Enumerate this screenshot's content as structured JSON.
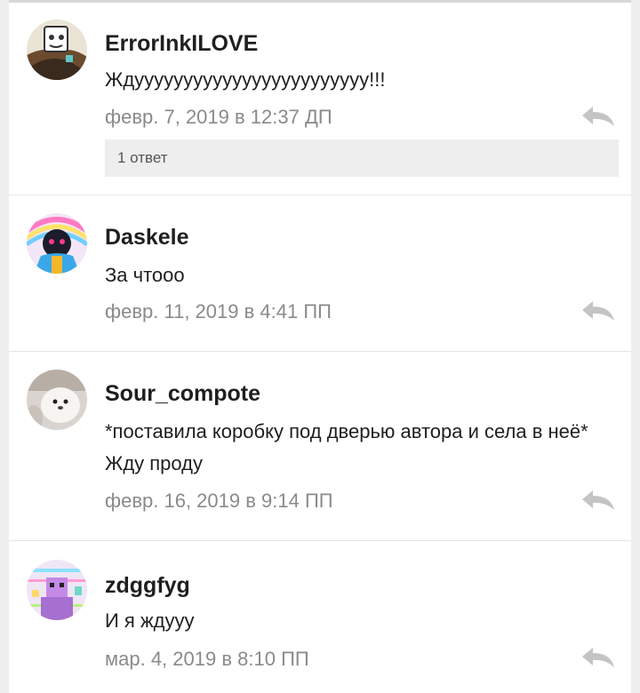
{
  "comments": [
    {
      "username": "ErrorInkILOVE",
      "text": "Ждуууууууууууууууууууууууу!!!",
      "date": "февр. 7, 2019 в 12:37 ДП",
      "replies": "1 ответ"
    },
    {
      "username": "Daskele",
      "text": "За чтооо",
      "date": "февр. 11, 2019 в 4:41 ПП"
    },
    {
      "username": "Sour_compote",
      "text": "*поставила коробку под дверью автора и села в неё* Жду проду",
      "date": "февр. 16, 2019 в 9:14 ПП"
    },
    {
      "username": "zdggfyg",
      "text": "И я ждууу",
      "date": "мар. 4, 2019 в 8:10 ПП"
    }
  ],
  "icons": {
    "reply": "reply-arrow-icon"
  },
  "colors": {
    "username": "#1f1f1f",
    "date": "#8a8a8a",
    "reply_icon": "#c4c4c4",
    "replies_bg": "#eeeeee"
  }
}
